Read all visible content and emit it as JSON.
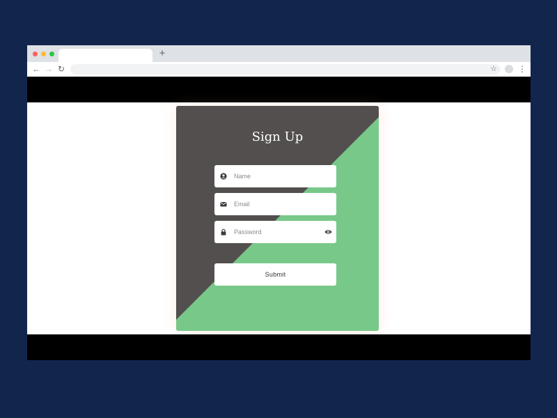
{
  "browser": {
    "tab_title": "",
    "new_tab_label": "+",
    "url": ""
  },
  "form": {
    "title": "Sign Up",
    "name_placeholder": "Name",
    "email_placeholder": "Email",
    "password_placeholder": "Password",
    "submit_label": "Submit"
  },
  "icons": {
    "fields": [
      "user-icon",
      "envelope-icon",
      "lock-icon"
    ],
    "password_toggle": "eye-icon"
  },
  "colors": {
    "page_background": "#12264d",
    "card_dark": "#534f4e",
    "card_green": "#78c88a",
    "letterbox": "#000000"
  }
}
